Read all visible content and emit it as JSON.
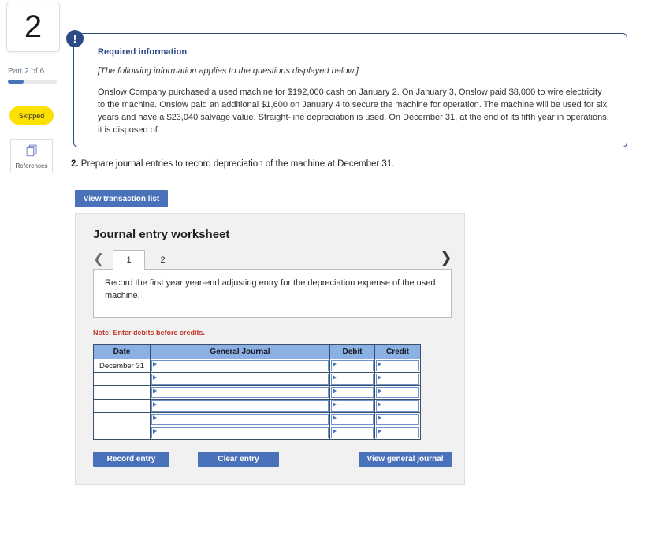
{
  "rail": {
    "question_number": "2",
    "part_prefix": "Part ",
    "part_current": "2",
    "part_suffix": " of 6",
    "progress_percent": 33,
    "status_badge": "Skipped",
    "references_label": "References",
    "references_icon": "copy-stack-icon"
  },
  "info": {
    "icon": "exclamation-icon",
    "title": "Required information",
    "italic_note": "[The following information applies to the questions displayed below.]",
    "body": "Onslow Company purchased a used machine for $192,000 cash on January 2. On January 3, Onslow paid $8,000 to wire electricity to the machine. Onslow paid an additional $1,600 on January 4 to secure the machine for operation. The machine will be used for six years and have a $23,040 salvage value. Straight-line depreciation is used. On December 31, at the end of its fifth year in operations, it is disposed of."
  },
  "question": {
    "number": "2.",
    "text": "Prepare journal entries to record depreciation of the machine at December 31."
  },
  "toolbar": {
    "view_transaction_list": "View transaction list"
  },
  "worksheet": {
    "title": "Journal entry worksheet",
    "prev_icon": "chevron-left-icon",
    "next_icon": "chevron-right-icon",
    "tabs": [
      {
        "label": "1",
        "active": true
      },
      {
        "label": "2",
        "active": false
      }
    ],
    "instruction": "Record the first year year-end adjusting entry for the depreciation expense of the used machine.",
    "note": "Note: Enter debits before credits.",
    "table": {
      "headers": [
        "Date",
        "General Journal",
        "Debit",
        "Credit"
      ],
      "rows": [
        {
          "date": "December 31",
          "general_journal": "",
          "debit": "",
          "credit": ""
        },
        {
          "date": "",
          "general_journal": "",
          "debit": "",
          "credit": ""
        },
        {
          "date": "",
          "general_journal": "",
          "debit": "",
          "credit": ""
        },
        {
          "date": "",
          "general_journal": "",
          "debit": "",
          "credit": ""
        },
        {
          "date": "",
          "general_journal": "",
          "debit": "",
          "credit": ""
        },
        {
          "date": "",
          "general_journal": "",
          "debit": "",
          "credit": ""
        }
      ]
    },
    "buttons": {
      "record_entry": "Record entry",
      "clear_entry": "Clear entry",
      "view_general_journal": "View general journal"
    }
  },
  "colors": {
    "accent_blue": "#4a72ba",
    "navy": "#2b4a86",
    "table_header_blue": "#8bb0e3",
    "badge_yellow": "#fcdf03",
    "note_red": "#c0392b"
  }
}
